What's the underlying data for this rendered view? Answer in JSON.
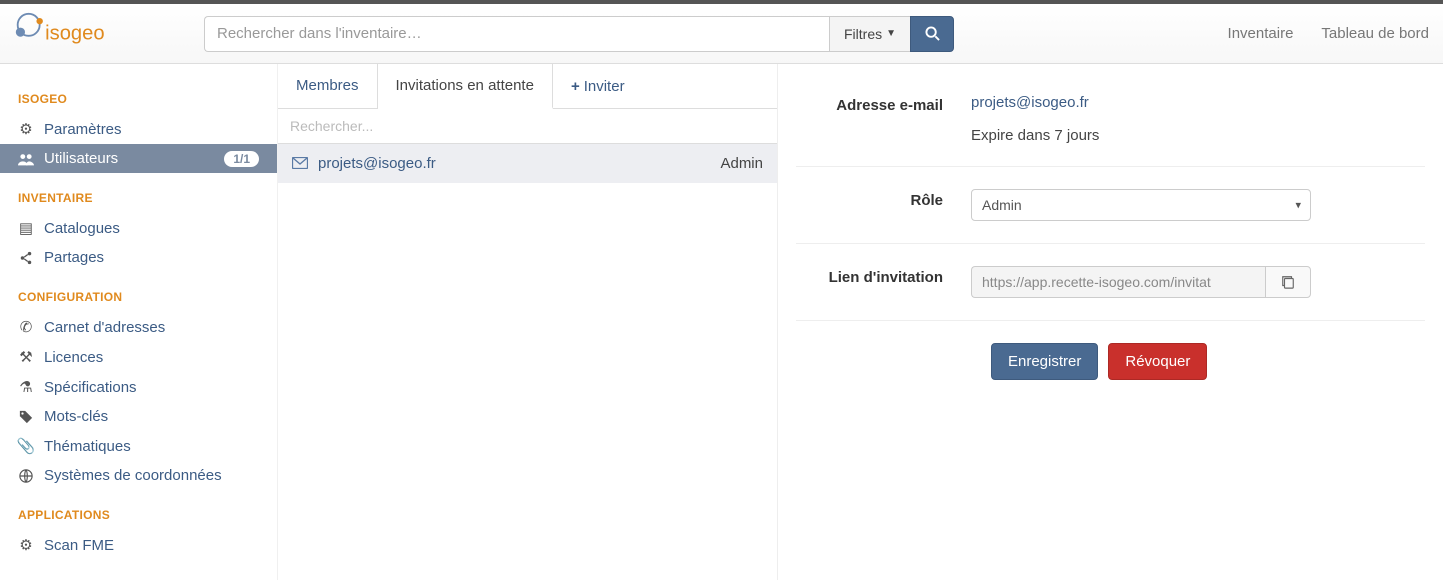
{
  "header": {
    "search_placeholder": "Rechercher dans l'inventaire…",
    "filters_label": "Filtres",
    "nav": {
      "inventory": "Inventaire",
      "dashboard": "Tableau de bord"
    }
  },
  "sidebar": {
    "sections": {
      "isogeo": {
        "title": "ISOGEO",
        "items": [
          {
            "label": "Paramètres",
            "icon": "gear"
          },
          {
            "label": "Utilisateurs",
            "icon": "users",
            "badge": "1/1",
            "active": true
          }
        ]
      },
      "inventaire": {
        "title": "INVENTAIRE",
        "items": [
          {
            "label": "Catalogues",
            "icon": "book"
          },
          {
            "label": "Partages",
            "icon": "share"
          }
        ]
      },
      "configuration": {
        "title": "CONFIGURATION",
        "items": [
          {
            "label": "Carnet d'adresses",
            "icon": "phone"
          },
          {
            "label": "Licences",
            "icon": "gavel"
          },
          {
            "label": "Spécifications",
            "icon": "flask"
          },
          {
            "label": "Mots-clés",
            "icon": "tags"
          },
          {
            "label": "Thématiques",
            "icon": "paperclip"
          },
          {
            "label": "Systèmes de coordonnées",
            "icon": "globe"
          }
        ]
      },
      "applications": {
        "title": "APPLICATIONS",
        "items": [
          {
            "label": "Scan FME",
            "icon": "gear"
          }
        ]
      }
    }
  },
  "tabs": {
    "members": "Membres",
    "pending": "Invitations en attente",
    "invite": "Inviter"
  },
  "list": {
    "search_placeholder": "Rechercher...",
    "items": [
      {
        "email": "projets@isogeo.fr",
        "role": "Admin"
      }
    ]
  },
  "detail": {
    "email_label": "Adresse e-mail",
    "email": "projets@isogeo.fr",
    "expiry": "Expire dans 7 jours",
    "role_label": "Rôle",
    "role_selected": "Admin",
    "link_label": "Lien d'invitation",
    "link_value": "https://app.recette-isogeo.com/invitat",
    "save": "Enregistrer",
    "revoke": "Révoquer"
  }
}
